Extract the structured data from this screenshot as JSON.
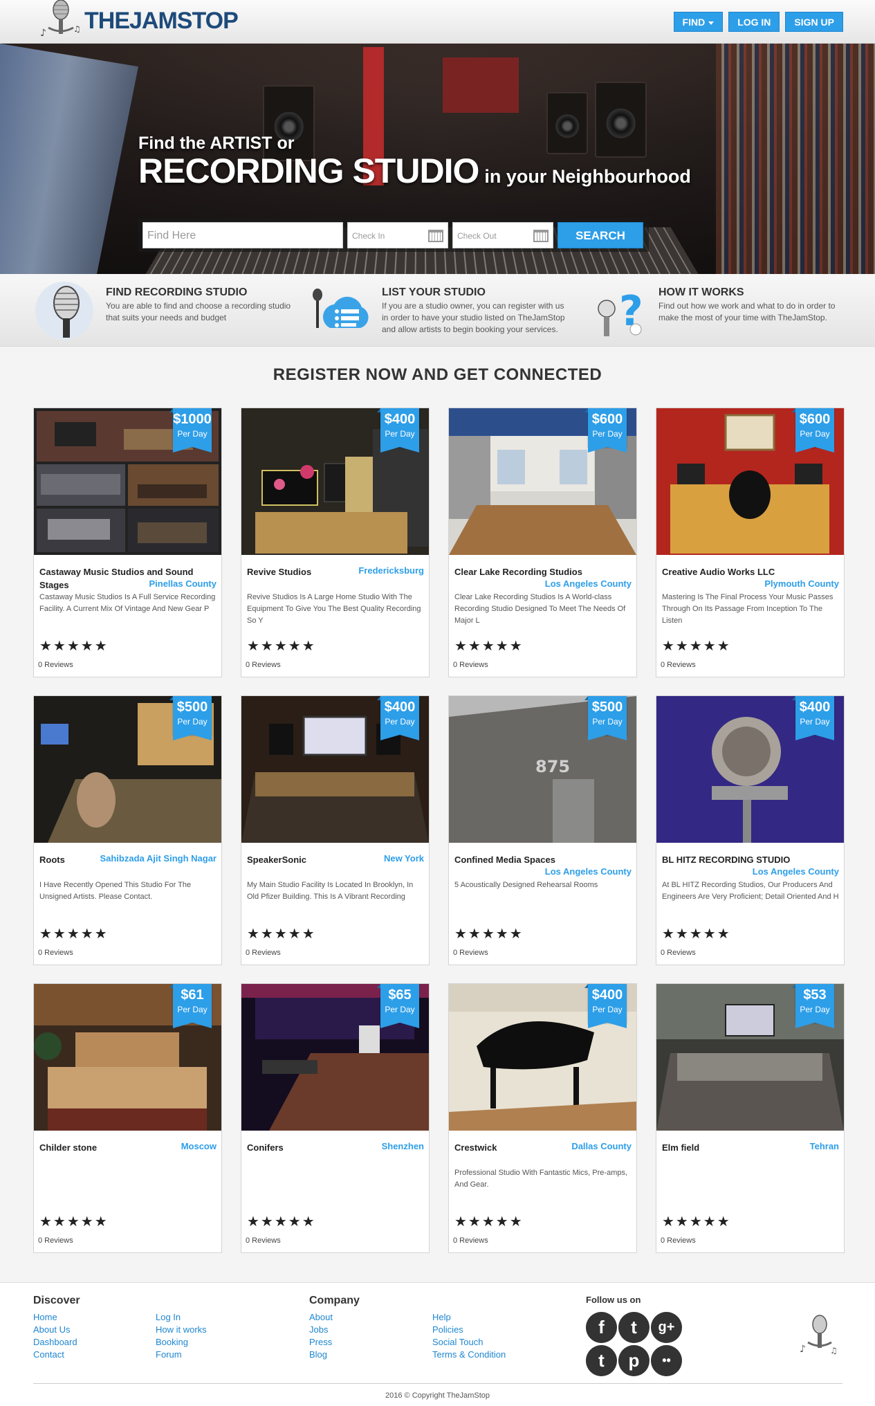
{
  "header": {
    "brand": "THEJAMSTOP",
    "nav": [
      {
        "label": "FIND",
        "dropdown": true
      },
      {
        "label": "LOG IN"
      },
      {
        "label": "SIGN UP"
      }
    ]
  },
  "hero": {
    "line1": "Find the ARTIST or",
    "line2": "RECORDING STUDIO",
    "line3": "in your Neighbourhood",
    "search": {
      "find_placeholder": "Find Here",
      "checkin_placeholder": "Check In",
      "checkout_placeholder": "Check Out",
      "button": "SEARCH"
    }
  },
  "features": [
    {
      "title": "FIND RECORDING STUDIO",
      "desc": "You are able to find and choose a recording studio that suits your needs and budget",
      "icon": "microphone-icon"
    },
    {
      "title": "LIST YOUR STUDIO",
      "desc": "If you are a studio owner, you can register with us in order to have your studio listed on TheJamStop and allow artists to begin booking your services.",
      "icon": "list-cloud-icon"
    },
    {
      "title": "HOW IT WORKS",
      "desc": "Find out how we work and what to do in order to make the most of your time with TheJamStop.",
      "icon": "question-mark-icon"
    }
  ],
  "section_title": "REGISTER NOW AND GET CONNECTED",
  "studios": [
    {
      "price": "$1000",
      "per": "Per Day",
      "name": "Castaway Music Studios and Sound Stages",
      "location": "Pinellas County",
      "desc": "Castaway Music Studios Is A Full Service Recording Facility. A Current Mix Of Vintage And New Gear P",
      "stars": "★★★★★",
      "reviews": "0 Reviews",
      "theme": "collage"
    },
    {
      "price": "$400",
      "per": "Per Day",
      "name": "Revive Studios",
      "location": "Fredericksburg",
      "desc": "Revive Studios Is A Large Home Studio With The Equipment To Give You The Best Quality Recording So Y",
      "stars": "★★★★★",
      "reviews": "0 Reviews",
      "theme": "dark"
    },
    {
      "price": "$600",
      "per": "Per Day",
      "name": "Clear Lake Recording Studios",
      "location": "Los Angeles County",
      "desc": "Clear Lake Recording Studios Is A World-class Recording Studio Designed To Meet The Needs Of Major L",
      "stars": "★★★★★",
      "reviews": "0 Reviews",
      "theme": "room"
    },
    {
      "price": "$600",
      "per": "Per Day",
      "name": "Creative Audio Works LLC",
      "location": "Plymouth County",
      "desc": "Mastering Is The Final Process Your Music Passes Through On Its Passage From Inception To The Listen",
      "stars": "★★★★★",
      "reviews": "0 Reviews",
      "theme": "red"
    },
    {
      "price": "$500",
      "per": "Per Day",
      "name": "Roots",
      "location": "Sahibzada Ajit Singh Nagar",
      "desc": "I Have Recently Opened This Studio For The Unsigned Artists. Please Contact.",
      "stars": "★★★★★",
      "reviews": "0 Reviews",
      "theme": "control"
    },
    {
      "price": "$400",
      "per": "Per Day",
      "name": "SpeakerSonic",
      "location": "New York",
      "desc": "My Main Studio Facility Is Located In Brooklyn, In Old Pfizer Building. This Is A Vibrant Recording",
      "stars": "★★★★★",
      "reviews": "0 Reviews",
      "theme": "desk"
    },
    {
      "price": "$500",
      "per": "Per Day",
      "name": "Confined Media Spaces",
      "location": "Los Angeles County",
      "desc": "5 Acoustically Designed Rehearsal Rooms",
      "stars": "★★★★★",
      "reviews": "0 Reviews",
      "theme": "building"
    },
    {
      "price": "$400",
      "per": "Per Day",
      "name": "BL HITZ RECORDING STUDIO",
      "location": "Los Angeles County",
      "desc": "At BL HITZ Recording Studios, Our Producers And Engineers Are Very Proficient; Detail Oriented And H",
      "stars": "★★★★★",
      "reviews": "0 Reviews",
      "theme": "purple"
    },
    {
      "price": "$61",
      "per": "Per Day",
      "name": "Childer stone",
      "location": "Moscow",
      "desc": "",
      "stars": "★★★★★",
      "reviews": "0 Reviews",
      "theme": "wood"
    },
    {
      "price": "$65",
      "per": "Per Day",
      "name": "Conifers",
      "location": "Shenzhen",
      "desc": "",
      "stars": "★★★★★",
      "reviews": "0 Reviews",
      "theme": "neon"
    },
    {
      "price": "$400",
      "per": "Per Day",
      "name": "Crestwick",
      "location": "Dallas County",
      "desc": "Professional Studio With Fantastic Mics, Pre-amps, And Gear.",
      "stars": "★★★★★",
      "reviews": "0 Reviews",
      "theme": "piano"
    },
    {
      "price": "$53",
      "per": "Per Day",
      "name": "Elm field",
      "location": "Tehran",
      "desc": "",
      "stars": "★★★★★",
      "reviews": "0 Reviews",
      "theme": "console"
    }
  ],
  "footer": {
    "discover_title": "Discover",
    "discover_col1": [
      "Home",
      "About Us",
      "Dashboard",
      "Contact"
    ],
    "discover_col2": [
      "Log In",
      "How it works",
      "Booking",
      "Forum"
    ],
    "company_title": "Company",
    "company_col1": [
      "About",
      "Jobs",
      "Press",
      "Blog"
    ],
    "company_col2": [
      "Help",
      "Policies",
      "Social Touch",
      "Terms & Condition"
    ],
    "follow_title": "Follow us on",
    "social": [
      {
        "glyph": "f",
        "icon": "facebook-icon"
      },
      {
        "glyph": "t",
        "icon": "twitter-icon"
      },
      {
        "glyph": "g+",
        "icon": "google-plus-icon"
      },
      {
        "glyph": "t",
        "icon": "tumblr-icon"
      },
      {
        "glyph": "p",
        "icon": "pinterest-icon"
      },
      {
        "glyph": "••",
        "icon": "flickr-icon"
      }
    ],
    "copyright": "2016 © Copyright TheJamStop"
  },
  "colors": {
    "accent": "#2d9ee8",
    "brand": "#1d4a7a",
    "text": "#333333"
  }
}
